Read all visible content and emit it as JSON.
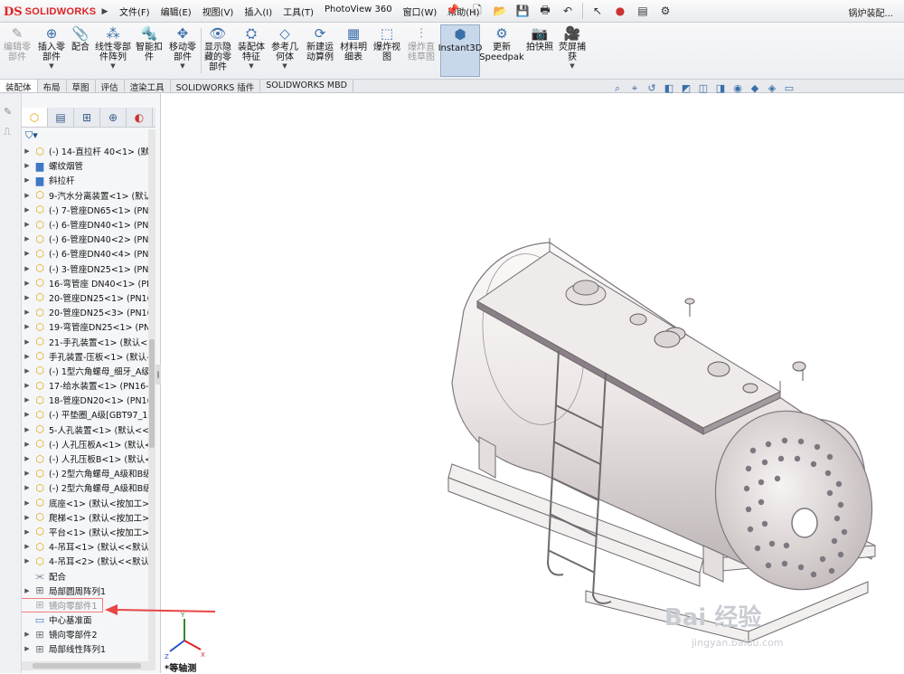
{
  "app": {
    "logo_ds": "DS",
    "logo_text": "SOLIDWORKS",
    "window_title": "锅炉装配..."
  },
  "menu": [
    "文件(F)",
    "编辑(E)",
    "视图(V)",
    "插入(I)",
    "工具(T)",
    "PhotoView 360",
    "窗口(W)",
    "帮助(H)"
  ],
  "commands": [
    {
      "label": "编辑零\n部件",
      "icon": "edit-component-icon",
      "disabled": true
    },
    {
      "label": "插入零\n部件",
      "icon": "insert-component-icon"
    },
    {
      "label": "配合",
      "icon": "mate-icon"
    },
    {
      "label": "线性零部\n件阵列",
      "icon": "linear-pattern-icon"
    },
    {
      "label": "智能扣\n件",
      "icon": "smart-fastener-icon"
    },
    {
      "label": "移动零\n部件",
      "icon": "move-component-icon"
    },
    {
      "label": "显示隐\n藏的零\n部件",
      "icon": "show-hidden-icon"
    },
    {
      "label": "装配体\n特征",
      "icon": "assembly-feature-icon"
    },
    {
      "label": "参考几\n何体",
      "icon": "reference-geometry-icon"
    },
    {
      "label": "新建运\n动算例",
      "icon": "motion-study-icon"
    },
    {
      "label": "材料明\n细表",
      "icon": "bom-icon"
    },
    {
      "label": "爆炸视\n图",
      "icon": "exploded-view-icon"
    },
    {
      "label": "爆炸直\n线草图",
      "icon": "explode-line-icon",
      "disabled": true
    },
    {
      "label": "Instant3D",
      "icon": "instant3d-icon",
      "active": true
    },
    {
      "label": "更新\nSpeedpak",
      "icon": "speedpak-icon"
    },
    {
      "label": "拍快照",
      "icon": "snapshot-icon"
    },
    {
      "label": "荧屏捕\n获",
      "icon": "screen-capture-icon"
    }
  ],
  "tabs": [
    "装配体",
    "布局",
    "草图",
    "评估",
    "渲染工具",
    "SOLIDWORKS 插件",
    "SOLIDWORKS MBD"
  ],
  "tree": [
    {
      "label": "(-) 14-直拉杆  40<1> (默",
      "icon": "part"
    },
    {
      "label": "螺纹烟管",
      "icon": "folder"
    },
    {
      "label": "斜拉杆",
      "icon": "folder"
    },
    {
      "label": "9-汽水分离装置<1> (默认",
      "icon": "part"
    },
    {
      "label": "(-) 7-管座DN65<1> (PN",
      "icon": "part"
    },
    {
      "label": "(-) 6-管座DN40<1> (PN",
      "icon": "part"
    },
    {
      "label": "(-) 6-管座DN40<2> (PN",
      "icon": "part"
    },
    {
      "label": "(-) 6-管座DN40<4> (PN",
      "icon": "part"
    },
    {
      "label": "(-) 3-管座DN25<1> (PN",
      "icon": "part"
    },
    {
      "label": "16-弯管座 DN40<1> (PN",
      "icon": "part"
    },
    {
      "label": "20-管座DN25<1> (PN16",
      "icon": "part"
    },
    {
      "label": "20-管座DN25<3> (PN16",
      "icon": "part"
    },
    {
      "label": "19-弯管座DN25<1> (PN",
      "icon": "part"
    },
    {
      "label": "21-手孔装置<1> (默认<",
      "icon": "part"
    },
    {
      "label": "手孔装置-压板<1> (默认-",
      "icon": "part"
    },
    {
      "label": "(-) 1型六角螺母_细牙_A级",
      "icon": "part"
    },
    {
      "label": "17-给水装置<1> (PN16-",
      "icon": "part"
    },
    {
      "label": "18-管座DN20<1> (PN16",
      "icon": "part"
    },
    {
      "label": "(-) 平垫圈_A级[GBT97_1-",
      "icon": "part"
    },
    {
      "label": "5-人孔装置<1> (默认<<默",
      "icon": "part"
    },
    {
      "label": "(-) 人孔压板A<1> (默认<",
      "icon": "part"
    },
    {
      "label": "(-) 人孔压板B<1> (默认<",
      "icon": "part"
    },
    {
      "label": "(-) 2型六角螺母_A级和B级",
      "icon": "part"
    },
    {
      "label": "(-) 2型六角螺母_A级和B级",
      "icon": "part"
    },
    {
      "label": "底座<1> (默认<按加工>",
      "icon": "part"
    },
    {
      "label": "爬梯<1> (默认<按加工>",
      "icon": "part"
    },
    {
      "label": "平台<1> (默认<按加工>",
      "icon": "part"
    },
    {
      "label": "4-吊耳<1> (默认<<默认",
      "icon": "part"
    },
    {
      "label": "4-吊耳<2> (默认<<默认",
      "icon": "part"
    },
    {
      "label": "配合",
      "icon": "mate",
      "noexpand": true
    },
    {
      "label": "局部圆周阵列1",
      "icon": "pattern"
    },
    {
      "label": "镜向零部件1",
      "icon": "pattern",
      "dimmed": true,
      "boxed": true,
      "noexpand": true
    },
    {
      "label": "中心基准面",
      "icon": "plane",
      "noexpand": true
    },
    {
      "label": "镜向零部件2",
      "icon": "pattern"
    },
    {
      "label": "局部线性阵列1",
      "icon": "pattern"
    }
  ],
  "view": {
    "orientation_label": "*等轴测"
  },
  "watermark": {
    "brand": "Bai 经验",
    "url": "jingyan.baidu.com"
  },
  "colors": {
    "body": "#f0ecec",
    "frame": "#7d7780",
    "highlight": "#e84545"
  }
}
